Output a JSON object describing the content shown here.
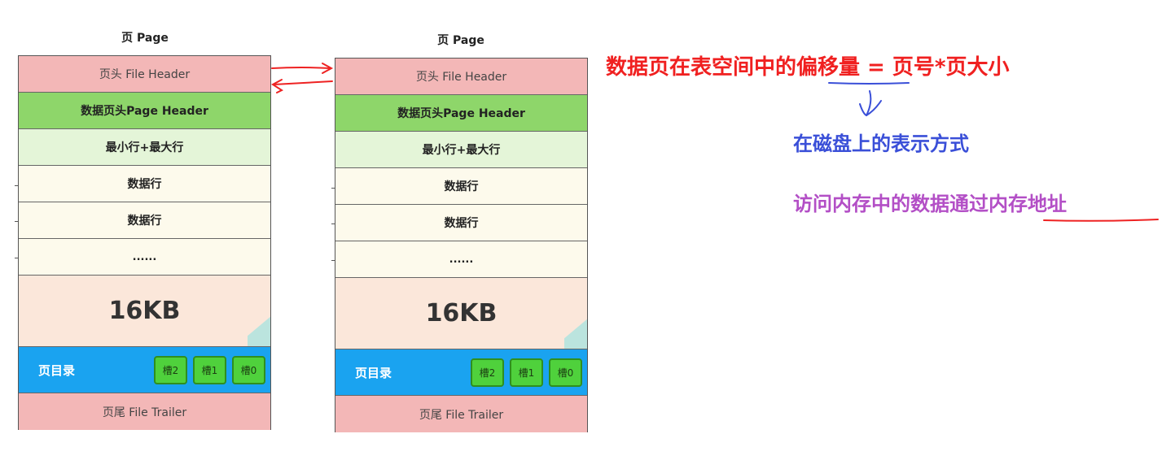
{
  "pages": [
    {
      "title": "页 Page",
      "file_header": "页头 File Header",
      "page_header": "数据页头Page Header",
      "min_max": "最小行+最大行",
      "data_row_1": "数据行",
      "data_row_2": "数据行",
      "ellipsis": "......",
      "size": "16KB",
      "directory": "页目录",
      "slots": [
        "槽2",
        "槽1",
        "槽0"
      ],
      "file_trailer": "页尾 File Trailer"
    },
    {
      "title": "页 Page",
      "file_header": "页头 File Header",
      "page_header": "数据页头Page Header",
      "min_max": "最小行+最大行",
      "data_row_1": "数据行",
      "data_row_2": "数据行",
      "ellipsis": "......",
      "size": "16KB",
      "directory": "页目录",
      "slots": [
        "槽2",
        "槽1",
        "槽0"
      ],
      "file_trailer": "页尾 File Trailer"
    }
  ],
  "annotations": {
    "formula": "数据页在表空间中的偏移量 = 页号*页大小",
    "disk_representation": "在磁盘上的表示方式",
    "memory_access": "访问内存中的数据通过内存地址"
  },
  "colors": {
    "header": "#f3b7b7",
    "page_header": "#8ed66a",
    "min_max": "#e4f5d8",
    "data_rows": "#fdfaec",
    "free_space": "#fbe7da",
    "directory": "#1aa3f0",
    "slot": "#4fd13c",
    "formula": "#f02020",
    "disk": "#3a4fd8",
    "memory": "#b34fc6"
  }
}
